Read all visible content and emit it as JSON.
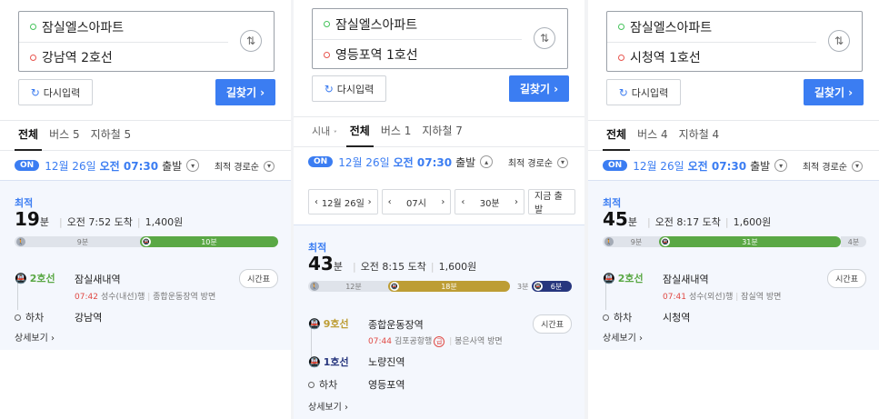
{
  "panels": [
    {
      "origin": "잠실엘스아파트",
      "destination": "강남역 2호선",
      "reset_label": "다시입력",
      "search_label": "길찾기 ›",
      "tabs": [
        "전체",
        "버스 5",
        "지하철 5"
      ],
      "on_label": "ON",
      "depart_date": "12월 26일",
      "depart_time": "오전 07:30",
      "depart_suffix": "출발",
      "sort_label": "최적 경로순",
      "best_label": "최적",
      "duration_num": "19",
      "duration_unit": "분",
      "arrival": "오전 7:52 도착",
      "fare": "1,400원",
      "bar": [
        {
          "type": "walk",
          "minutes": 9,
          "label": "9분"
        },
        {
          "type": "line2",
          "minutes": 10,
          "label": "10분"
        }
      ],
      "steps": {
        "line_label": "2호선",
        "line_color": "#5aa845",
        "board_station": "잠실새내역",
        "train_time": "07:42",
        "train_info": "성수(내선)행",
        "direction": "종합운동장역 방면",
        "timetable_label": "시간표",
        "alight_label": "하차",
        "alight_station": "강남역"
      },
      "detail_label": "상세보기 ›"
    },
    {
      "origin": "잠실엘스아파트",
      "destination": "영등포역 1호선",
      "reset_label": "다시입력",
      "search_label": "길찾기 ›",
      "region_label": "시내",
      "tabs": [
        "전체",
        "버스 1",
        "지하철 7"
      ],
      "on_label": "ON",
      "depart_date": "12월 26일",
      "depart_time": "오전 07:30",
      "depart_suffix": "출발",
      "sort_label": "최적 경로순",
      "picker": {
        "date": "12월 26일",
        "hour": "07시",
        "minute": "30분",
        "now": "지금 출발"
      },
      "best_label": "최적",
      "duration_num": "43",
      "duration_unit": "분",
      "arrival": "오전 8:15 도착",
      "fare": "1,600원",
      "bar": [
        {
          "type": "walk",
          "minutes": 12,
          "label": "12분"
        },
        {
          "type": "line9",
          "minutes": 18,
          "label": "18분"
        },
        {
          "type": "walk-plain",
          "minutes": 3,
          "label": "3분"
        },
        {
          "type": "line1",
          "minutes": 6,
          "label": "6분"
        }
      ],
      "steps": {
        "line_label": "9호선",
        "line_color": "#bd9d34",
        "board_station": "종합운동장역",
        "train_time": "07:44",
        "train_info": "김포공항행",
        "express": "급",
        "direction": "봉은사역 방면",
        "timetable_label": "시간표",
        "line2_label": "1호선",
        "line2_color": "#27367e",
        "transfer_station": "노량진역",
        "alight_label": "하차",
        "alight_station": "영등포역"
      },
      "detail_label": "상세보기 ›"
    },
    {
      "origin": "잠실엘스아파트",
      "destination": "시청역 1호선",
      "reset_label": "다시입력",
      "search_label": "길찾기 ›",
      "tabs": [
        "전체",
        "버스 4",
        "지하철 4"
      ],
      "on_label": "ON",
      "depart_date": "12월 26일",
      "depart_time": "오전 07:30",
      "depart_suffix": "출발",
      "sort_label": "최적 경로순",
      "best_label": "최적",
      "duration_num": "45",
      "duration_unit": "분",
      "arrival": "오전 8:17 도착",
      "fare": "1,600원",
      "bar": [
        {
          "type": "walk",
          "minutes": 9,
          "label": "9분"
        },
        {
          "type": "line2",
          "minutes": 31,
          "label": "31분"
        },
        {
          "type": "walk-plain",
          "minutes": 4,
          "label": "4분"
        }
      ],
      "steps": {
        "line_label": "2호선",
        "line_color": "#5aa845",
        "board_station": "잠실새내역",
        "train_time": "07:41",
        "train_info": "성수(외선)행",
        "direction": "잠실역 방면",
        "timetable_label": "시간표",
        "alight_label": "하차",
        "alight_station": "시청역"
      },
      "detail_label": "상세보기 ›"
    }
  ]
}
